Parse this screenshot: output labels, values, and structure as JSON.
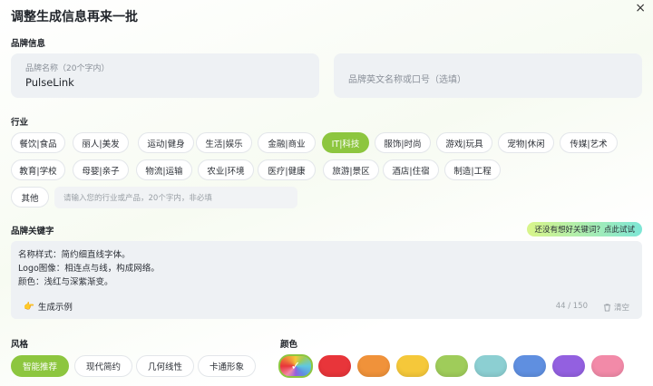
{
  "dialog": {
    "title": "调整生成信息再来一批",
    "close_icon": "×"
  },
  "brand_info": {
    "section_label": "品牌信息",
    "name_field": {
      "label": "品牌名称（20个字内）",
      "value": "PulseLink"
    },
    "english_field": {
      "placeholder": "品牌英文名称或口号（选填）"
    }
  },
  "industry": {
    "section_label": "行业",
    "items": [
      {
        "label": "餐饮|食品",
        "active": false
      },
      {
        "label": "丽人|美发",
        "active": false
      },
      {
        "label": "运动|健身",
        "active": false
      },
      {
        "label": "生活|娱乐",
        "active": false
      },
      {
        "label": "金融|商业",
        "active": false
      },
      {
        "label": "IT|科技",
        "active": true
      },
      {
        "label": "服饰|时尚",
        "active": false
      },
      {
        "label": "游戏|玩具",
        "active": false
      },
      {
        "label": "宠物|休闲",
        "active": false
      },
      {
        "label": "传媒|艺术",
        "active": false
      },
      {
        "label": "教育|学校",
        "active": false
      },
      {
        "label": "母婴|亲子",
        "active": false
      },
      {
        "label": "物流|运输",
        "active": false
      },
      {
        "label": "农业|环境",
        "active": false
      },
      {
        "label": "医疗|健康",
        "active": false
      },
      {
        "label": "旅游|景区",
        "active": false
      },
      {
        "label": "酒店|住宿",
        "active": false
      },
      {
        "label": "制造|工程",
        "active": false
      }
    ],
    "other_label": "其他",
    "other_placeholder": "请输入您的行业或产品，20个字内，非必填"
  },
  "keywords": {
    "section_label": "品牌关键字",
    "hint": "还没有想好关键词？点此试试",
    "text": "名称样式：简约细直线字体。\nLogo图像：相连点与线，构成网络。\n颜色：浅红与深紫渐变。",
    "example_label": "生成示例",
    "example_icon": "👉",
    "counter": "44 / 150",
    "clear_label": "清空",
    "clear_icon": "trash-icon"
  },
  "style": {
    "section_label": "风格",
    "items": [
      {
        "label": "智能推荐",
        "active": true
      },
      {
        "label": "现代简约",
        "active": false
      },
      {
        "label": "几何线性",
        "active": false
      },
      {
        "label": "卡通形象",
        "active": false
      }
    ]
  },
  "color": {
    "section_label": "颜色",
    "selected_check": "✓",
    "swatches": [
      {
        "name": "rainbow",
        "color": "conic",
        "selected": true
      },
      {
        "name": "red",
        "color": "#e8353a",
        "selected": false
      },
      {
        "name": "orange",
        "color": "#f0923a",
        "selected": false
      },
      {
        "name": "yellow",
        "color": "#f5c83a",
        "selected": false
      },
      {
        "name": "green",
        "color": "#9fcc5a",
        "selected": false
      },
      {
        "name": "teal",
        "color": "#8ccfd2",
        "selected": false
      },
      {
        "name": "blue",
        "color": "#5f8fe0",
        "selected": false
      },
      {
        "name": "purple",
        "color": "#9360e0",
        "selected": false
      },
      {
        "name": "pink",
        "color": "#f28aa8",
        "selected": false
      }
    ]
  }
}
